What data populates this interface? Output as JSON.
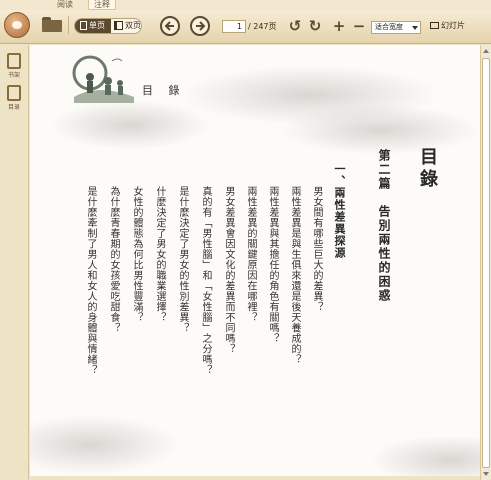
{
  "tabs": [
    {
      "label": "阅读"
    },
    {
      "label": "注释"
    }
  ],
  "toolbar": {
    "app_logo_icon": "app-logo-icon",
    "open_icon": "folder-icon",
    "page_mode": {
      "single_label": "单页",
      "double_label": "双页",
      "selected": "single"
    },
    "prev_icon": "arrow-left-icon",
    "next_icon": "arrow-right-icon",
    "current_page": "1",
    "total_pages": "/ 247页",
    "rotate_left_icon": "rotate-ccw-icon",
    "rotate_right_icon": "rotate-cw-icon",
    "zoom_in_icon": "plus-icon",
    "zoom_out_icon": "minus-icon",
    "zoom_mode": "适合宽度",
    "slideshow_label": "幻灯片",
    "accent_color": "#5b4a30"
  },
  "sidebar": {
    "items": [
      {
        "label": "书架",
        "icon": "bookshelf-icon"
      },
      {
        "label": "目录",
        "icon": "toc-icon"
      }
    ]
  },
  "document": {
    "page_heading": "目 錄",
    "toc_title": "目錄",
    "chapter": "第二篇　告別兩性的困惑",
    "section": "一、兩性差異探源",
    "items": [
      "男女間有哪些巨大的差異？",
      "兩性差異是與生俱來還是後天養成的？",
      "兩性差異與其擔任的角色有關嗎？",
      "兩性差異的關鍵原因在哪裡？",
      "男女差異會因文化的差異而不同嗎？",
      "真的有「男性腦」和「女性腦」之分嗎？",
      "是什麼決定了男女的性別差異？",
      "什麼決定了男女的職業選擇？",
      "女性的體態為何比男性豐滿？",
      "為什麼青春期的女孩愛吃甜食？",
      "是什麼牽制了男人和女人的身體與情緒？"
    ]
  }
}
